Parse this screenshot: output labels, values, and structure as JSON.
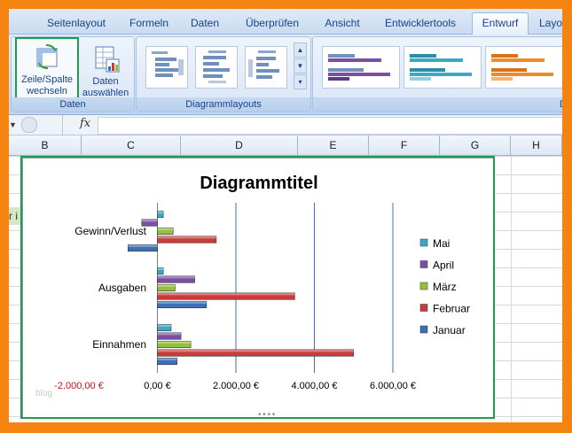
{
  "ribbon": {
    "tabs": [
      "Seitenlayout",
      "Formeln",
      "Daten",
      "Überprüfen",
      "Ansicht",
      "Entwicklertools",
      "Entwurf",
      "Layo"
    ],
    "active_tab": "Entwurf",
    "groups": {
      "daten": {
        "label": "Daten",
        "switch_button": [
          "Zeile/Spalte",
          "wechseln"
        ],
        "select_button": [
          "Daten",
          "auswählen"
        ]
      },
      "layouts": {
        "label": "Diagrammlayouts"
      },
      "styles": {
        "label": "D"
      }
    }
  },
  "formula_bar": {
    "fx": "fx"
  },
  "columns": [
    "B",
    "C",
    "D",
    "E",
    "F",
    "G",
    "H"
  ],
  "sheet": {
    "cut_text": "r i",
    "watermark": "blog"
  },
  "colors": {
    "Mai": "#3aa9c6",
    "April": "#7b4ea3",
    "März": "#97bf3c",
    "Februar": "#cc3b3b",
    "Januar": "#3d6fb7",
    "outline": "#1e9e4a",
    "frame": "#f5830f"
  },
  "chart_data": {
    "type": "bar",
    "orientation": "horizontal",
    "title": "Diagrammtitel",
    "categories": [
      "Einnahmen",
      "Ausgaben",
      "Gewinn/Verlust"
    ],
    "series": [
      {
        "name": "Januar",
        "values": [
          500,
          1250,
          -750
        ]
      },
      {
        "name": "Februar",
        "values": [
          5000,
          3500,
          1500
        ]
      },
      {
        "name": "März",
        "values": [
          850,
          450,
          400
        ]
      },
      {
        "name": "April",
        "values": [
          600,
          950,
          -400
        ]
      },
      {
        "name": "Mai",
        "values": [
          350,
          150,
          150
        ]
      }
    ],
    "xlim": [
      -2000,
      6000
    ],
    "xticks": [
      -2000,
      0,
      2000,
      4000,
      6000
    ],
    "xtick_labels": [
      "-2.000,00 €",
      "0,00 €",
      "2.000,00 €",
      "4.000,00 €",
      "6.000,00 €"
    ],
    "legend": [
      "Mai",
      "April",
      "März",
      "Februar",
      "Januar"
    ],
    "legend_position": "right",
    "grid": "vertical major gridlines"
  }
}
